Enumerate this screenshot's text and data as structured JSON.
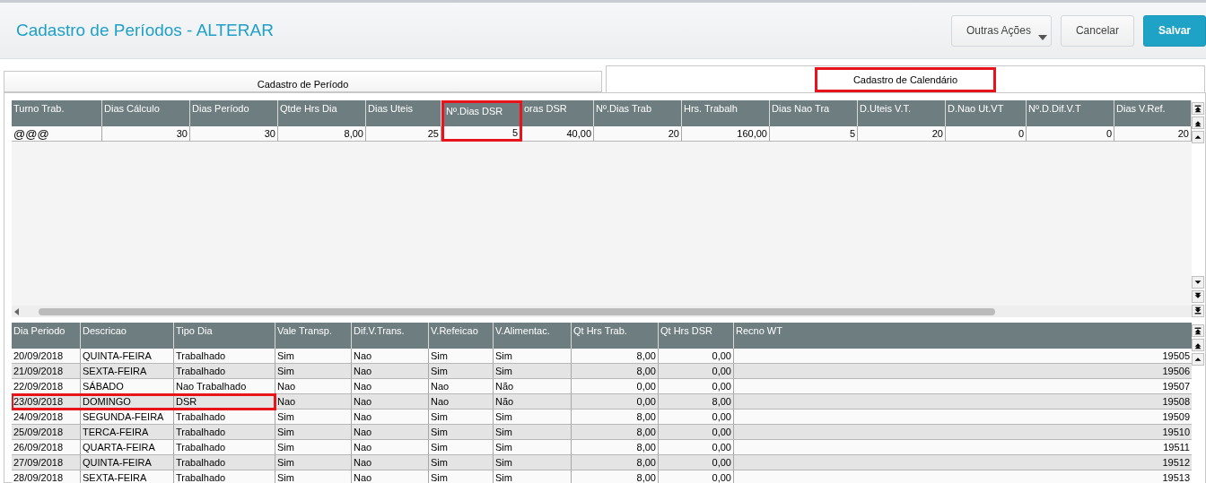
{
  "header": {
    "title": "Cadastro de Períodos - ALTERAR",
    "buttons": [
      {
        "label": "Outras Ações",
        "kind": "menu"
      },
      {
        "label": "Cancelar",
        "kind": "plain"
      },
      {
        "label": "Salvar",
        "kind": "primary"
      }
    ]
  },
  "tabs": [
    {
      "label": "Cadastro de Período",
      "selected": false,
      "highlighted": false
    },
    {
      "label": "Cadastro de Calendário",
      "selected": true,
      "highlighted": true
    }
  ],
  "summary_table": {
    "columns": [
      {
        "label": "Turno Trab.",
        "highlighted": false
      },
      {
        "label": "Dias Cálculo",
        "highlighted": false
      },
      {
        "label": "Dias Período",
        "highlighted": false
      },
      {
        "label": "Qtde Hrs Dia",
        "highlighted": false
      },
      {
        "label": "Dias Uteis",
        "highlighted": false
      },
      {
        "label": "Nº.Dias DSR",
        "highlighted": true
      },
      {
        "label": "oras DSR",
        "highlighted": false
      },
      {
        "label": "Nº.Dias Trab",
        "highlighted": false
      },
      {
        "label": "Hrs. Trabalh",
        "highlighted": false
      },
      {
        "label": "Dias Nao Tra",
        "highlighted": false
      },
      {
        "label": "D.Uteis V.T.",
        "highlighted": false
      },
      {
        "label": "D.Nao Ut.VT",
        "highlighted": false
      },
      {
        "label": "Nº.D.Dif.V.T",
        "highlighted": false
      },
      {
        "label": "Dias V.Ref.",
        "highlighted": false
      }
    ],
    "rows": [
      [
        "@@@",
        "30",
        "30",
        "8,00",
        "25",
        "5",
        "40,00",
        "20",
        "160,00",
        "5",
        "20",
        "0",
        "0",
        "20"
      ]
    ]
  },
  "calendar_table": {
    "columns": [
      "Dia Periodo",
      "Descricao",
      "Tipo Dia",
      "Vale Transp.",
      "Dif.V.Trans.",
      "V.Refeicao",
      "V.Alimentac.",
      "Qt Hrs Trab.",
      "Qt Hrs DSR",
      "Recno WT"
    ],
    "rows": [
      {
        "highlighted": false,
        "cells": [
          "20/09/2018",
          "QUINTA-FEIRA",
          "Trabalhado",
          "Sim",
          "Nao",
          "Sim",
          "Sim",
          "8,00",
          "0,00",
          "19505"
        ]
      },
      {
        "highlighted": false,
        "cells": [
          "21/09/2018",
          "SEXTA-FEIRA",
          "Trabalhado",
          "Sim",
          "Nao",
          "Sim",
          "Sim",
          "8,00",
          "0,00",
          "19506"
        ]
      },
      {
        "highlighted": false,
        "cells": [
          "22/09/2018",
          "SÁBADO",
          "Nao Trabalhado",
          "Nao",
          "Nao",
          "Nao",
          "Não",
          "0,00",
          "0,00",
          "19507"
        ]
      },
      {
        "highlighted": true,
        "cells": [
          "23/09/2018",
          "DOMINGO",
          "DSR",
          "Nao",
          "Nao",
          "Nao",
          "Não",
          "0,00",
          "8,00",
          "19508"
        ]
      },
      {
        "highlighted": false,
        "cells": [
          "24/09/2018",
          "SEGUNDA-FEIRA",
          "Trabalhado",
          "Sim",
          "Nao",
          "Sim",
          "Sim",
          "8,00",
          "0,00",
          "19509"
        ]
      },
      {
        "highlighted": false,
        "cells": [
          "25/09/2018",
          "TERCA-FEIRA",
          "Trabalhado",
          "Sim",
          "Nao",
          "Sim",
          "Sim",
          "8,00",
          "0,00",
          "19510"
        ]
      },
      {
        "highlighted": false,
        "cells": [
          "26/09/2018",
          "QUARTA-FEIRA",
          "Trabalhado",
          "Sim",
          "Nao",
          "Sim",
          "Sim",
          "8,00",
          "0,00",
          "19511"
        ]
      },
      {
        "highlighted": false,
        "cells": [
          "27/09/2018",
          "QUINTA-FEIRA",
          "Trabalhado",
          "Sim",
          "Nao",
          "Sim",
          "Sim",
          "8,00",
          "0,00",
          "19512"
        ]
      },
      {
        "highlighted": false,
        "cells": [
          "28/09/2018",
          "SEXTA-FEIRA",
          "Trabalhado",
          "Sim",
          "Nao",
          "Sim",
          "Sim",
          "8,00",
          "0,00",
          "19513"
        ]
      }
    ]
  }
}
